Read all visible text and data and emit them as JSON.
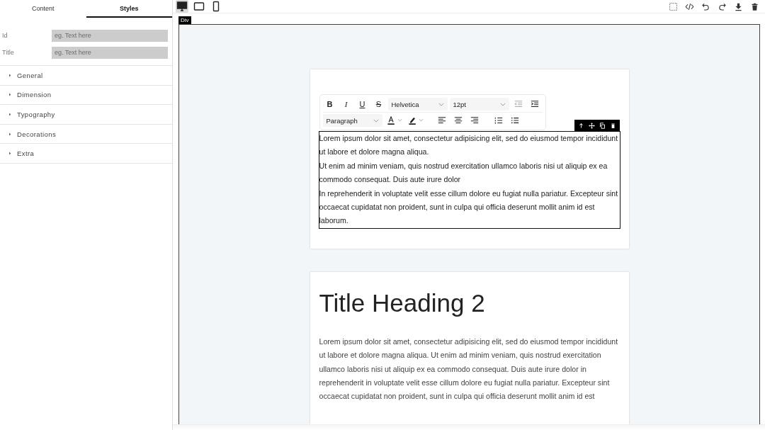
{
  "sidebar": {
    "tabs": [
      {
        "label": "Content",
        "selected": false
      },
      {
        "label": "Styles",
        "selected": true
      }
    ],
    "fields": [
      {
        "label": "Id",
        "placeholder": "eg. Text here"
      },
      {
        "label": "Title",
        "placeholder": "eg. Text here"
      }
    ],
    "sections": [
      {
        "label": "General",
        "expanded": false
      },
      {
        "label": "Dimension",
        "expanded": false
      },
      {
        "label": "Typography",
        "expanded": false
      },
      {
        "label": "Decorations",
        "expanded": false
      },
      {
        "label": "Extra",
        "expanded": false
      }
    ]
  },
  "devices": [
    {
      "kind": "desktop",
      "selected": true
    },
    {
      "kind": "tablet",
      "selected": false
    },
    {
      "kind": "mobile",
      "selected": false
    }
  ],
  "actions": [
    {
      "kind": "select"
    },
    {
      "kind": "code"
    },
    {
      "kind": "undo"
    },
    {
      "kind": "redo"
    },
    {
      "kind": "download"
    },
    {
      "kind": "delete"
    }
  ],
  "canvas": {
    "badge": "Div",
    "rte": {
      "format_buttons": [
        {
          "kind": "bold",
          "label": "B"
        },
        {
          "kind": "italic",
          "label": "I"
        },
        {
          "kind": "underline",
          "label": "U"
        },
        {
          "kind": "strike",
          "label": "S"
        }
      ],
      "font": "Helvetica",
      "size": "12pt",
      "block": "Paragraph"
    },
    "cards": [
      {
        "selected": true,
        "paragraphs": [
          "Lorem ipsum dolor sit amet, consectetur adipisicing elit, sed do eiusmod tempor incididunt ut labore et dolore magna aliqua.",
          "Ut enim ad minim veniam, quis nostrud exercitation ullamco laboris nisi ut aliquip ex ea commodo consequat. Duis aute irure dolor",
          "In reprehenderit in voluptate velit esse cillum dolore eu fugiat nulla pariatur. Excepteur sint occaecat cupidatat non proident, sunt in culpa qui officia deserunt mollit anim id est laborum."
        ]
      },
      {
        "title": "Title Heading 2",
        "selected": false,
        "paragraphs": [
          "Lorem ipsum dolor sit amet, consectetur adipisicing elit, sed do eiusmod tempor incididunt ut labore et dolore magna aliqua. Ut enim ad minim veniam, quis nostrud exercitation ullamco laboris nisi ut aliquip ex ea commodo consequat. Duis aute irure dolor in reprehenderit in voluptate velit esse cillum dolore eu fugiat nulla pariatur. Excepteur sint occaecat cupidatat non proident, sunt in culpa qui officia deserunt mollit anim id est"
        ]
      }
    ]
  }
}
